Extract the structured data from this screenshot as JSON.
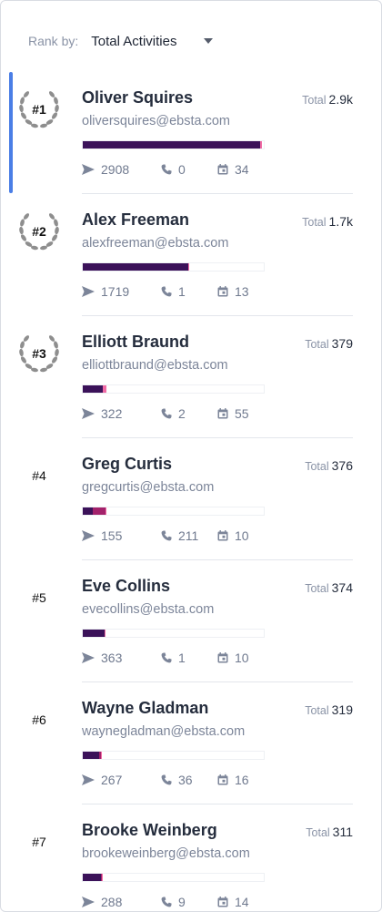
{
  "rank_by": {
    "label": "Rank by:",
    "value": "Total Activities"
  },
  "total_label": "Total",
  "leaderboard": [
    {
      "rank": "#1",
      "name": "Oliver Squires",
      "email": "oliversquires@ebsta.com",
      "total": "2.9k",
      "emails": "2908",
      "calls": "0",
      "meetings": "34",
      "bar": [
        0.98,
        0.0,
        0.012
      ],
      "wreath": true,
      "active": true
    },
    {
      "rank": "#2",
      "name": "Alex Freeman",
      "email": "alexfreeman@ebsta.com",
      "total": "1.7k",
      "emails": "1719",
      "calls": "1",
      "meetings": "13",
      "bar": [
        0.585,
        0.0,
        0.006
      ],
      "wreath": true,
      "active": false
    },
    {
      "rank": "#3",
      "name": "Elliott Braund",
      "email": "elliottbraund@ebsta.com",
      "total": "379",
      "emails": "322",
      "calls": "2",
      "meetings": "55",
      "bar": [
        0.109,
        0.0,
        0.019
      ],
      "wreath": true,
      "active": false
    },
    {
      "rank": "#4",
      "name": "Greg Curtis",
      "email": "gregcurtis@ebsta.com",
      "total": "376",
      "emails": "155",
      "calls": "211",
      "meetings": "10",
      "bar": [
        0.053,
        0.072,
        0.004
      ],
      "wreath": false,
      "active": false
    },
    {
      "rank": "#5",
      "name": "Eve Collins",
      "email": "evecollins@ebsta.com",
      "total": "374",
      "emails": "363",
      "calls": "1",
      "meetings": "10",
      "bar": [
        0.123,
        0.0,
        0.004
      ],
      "wreath": false,
      "active": false
    },
    {
      "rank": "#6",
      "name": "Wayne Gladman",
      "email": "waynegladman@ebsta.com",
      "total": "319",
      "emails": "267",
      "calls": "36",
      "meetings": "16",
      "bar": [
        0.09,
        0.012,
        0.006
      ],
      "wreath": false,
      "active": false
    },
    {
      "rank": "#7",
      "name": "Brooke Weinberg",
      "email": "brookeweinberg@ebsta.com",
      "total": "311",
      "emails": "288",
      "calls": "9",
      "meetings": "14",
      "bar": [
        0.098,
        0.003,
        0.005
      ],
      "wreath": false,
      "active": false
    }
  ],
  "icons": {
    "emails": "send-icon",
    "calls": "phone-icon",
    "meetings": "calendar-icon",
    "badge": "laurel-wreath-icon"
  },
  "colors": {
    "accent": "#4a7ee6",
    "bar_emails": "#3b1259",
    "bar_calls": "#a3226b",
    "bar_meetings": "#f06aa4"
  }
}
